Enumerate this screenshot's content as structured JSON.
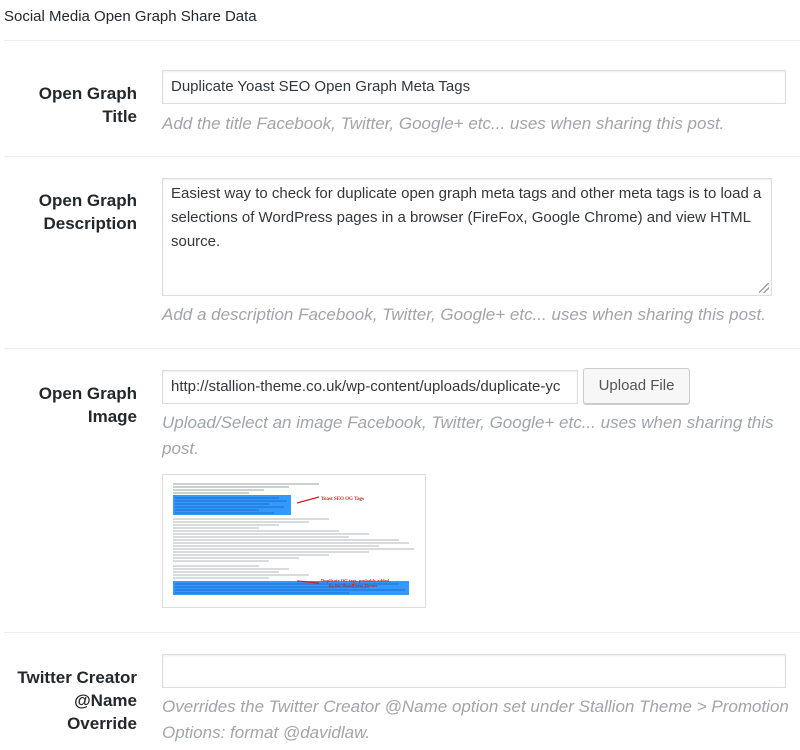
{
  "metabox": {
    "title": "Social Media Open Graph Share Data"
  },
  "og_title": {
    "label_line1": "Open Graph",
    "label_line2": "Title",
    "value": "Duplicate Yoast SEO Open Graph Meta Tags",
    "description": "Add the title Facebook, Twitter, Google+ etc... uses when sharing this post."
  },
  "og_description": {
    "label_line1": "Open Graph",
    "label_line2": "Description",
    "value_line1": "Easiest way to check for duplicate open graph meta tags and other meta tags is to load a",
    "value_line2": "selections of WordPress pages in a browser (FireFox, Google Chrome) and view HTML",
    "value_line3": "source.",
    "description": "Add a description Facebook, Twitter, Google+ etc... uses when sharing this post."
  },
  "og_image": {
    "label_line1": "Open Graph",
    "label_line2": "Image",
    "value": "http://stallion-theme.co.uk/wp-content/uploads/duplicate-yc",
    "upload_button_label": "Upload File",
    "description_line1": "Upload/Select an image Facebook, Twitter, Google+ etc... uses when sharing this",
    "description_line2": "post.",
    "preview": {
      "annotation1": "Yoast SEO OG Tags",
      "annotation2_line1": "Duplicate OG tags, probably added",
      "annotation2_line2": "by the WordPress Theme",
      "accent_color": "#3399ff",
      "annotation_color": "#cc2222"
    }
  },
  "twitter_creator": {
    "label_line1": "Twitter Creator",
    "label_line2": "@Name",
    "label_line3": "Override",
    "value": "",
    "description_line1": "Overrides the Twitter Creator @Name option set under Stallion Theme > Promotion",
    "description_line2": "Options: format @davidlaw."
  }
}
